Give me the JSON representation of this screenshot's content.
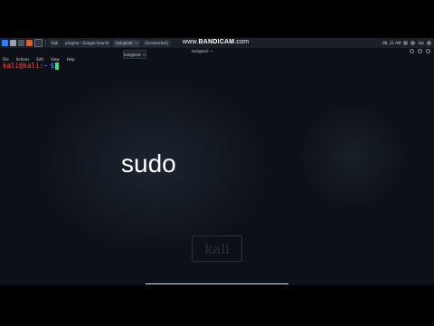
{
  "taskbar": {
    "tasks": [
      "Kali",
      "pingme - Google Search",
      "kali@kali: ~",
      "[Screenshot]"
    ],
    "tray_text": [
      "88, 21 AM",
      "Sat"
    ]
  },
  "watermark": {
    "prefix": "www.",
    "brand": "BANDICAM",
    "suffix": ".com"
  },
  "window": {
    "tab_label": "kali@kali: ~",
    "title": "kali@kali: ~"
  },
  "menu": {
    "items": [
      "File",
      "Actions",
      "Edit",
      "View",
      "Help"
    ]
  },
  "terminal": {
    "user_host": "kali@kali",
    "separator": ":",
    "path": "~",
    "symbol": "$"
  },
  "overlay": {
    "word": "sudo"
  },
  "logo": {
    "text": "kali"
  },
  "colors": {
    "background": "#0d1117",
    "prompt_user": "#ff4c4c",
    "prompt_path": "#6b8cff",
    "cursor": "#3ddc84"
  }
}
